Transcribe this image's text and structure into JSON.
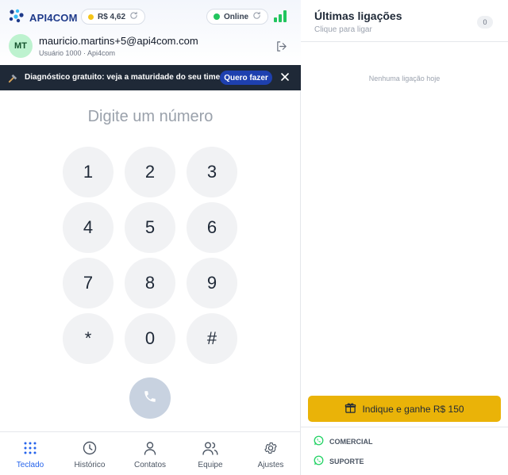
{
  "header": {
    "brand": "API4COM",
    "balance": "R$ 4,62",
    "status": "Online"
  },
  "user": {
    "initials": "MT",
    "email": "mauricio.martins+5@api4com.com",
    "subtitle": "Usuário 1000 · Api4com"
  },
  "banner": {
    "text": "Diagnóstico gratuito: veja a maturidade do seu time",
    "button": "Quero fazer"
  },
  "dialer": {
    "placeholder": "Digite um número",
    "keys": [
      "1",
      "2",
      "3",
      "4",
      "5",
      "6",
      "7",
      "8",
      "9",
      "*",
      "0",
      "#"
    ]
  },
  "nav": {
    "items": [
      {
        "label": "Teclado",
        "icon": "grid-icon",
        "active": true
      },
      {
        "label": "Histórico",
        "icon": "clock-icon",
        "active": false
      },
      {
        "label": "Contatos",
        "icon": "user-icon",
        "active": false
      },
      {
        "label": "Equipe",
        "icon": "users-icon",
        "active": false
      },
      {
        "label": "Ajustes",
        "icon": "gear-icon",
        "active": false
      }
    ]
  },
  "recent": {
    "title": "Últimas ligações",
    "subtitle": "Clique para ligar",
    "count": "0",
    "empty": "Nenhuma ligação hoje"
  },
  "referral": {
    "label": "Indique e ganhe R$ 150"
  },
  "support": {
    "commercial": "COMERCIAL",
    "support": "SUPORTE"
  },
  "colors": {
    "brand": "#1e3a8a",
    "accent": "#2563eb",
    "online": "#22c55e",
    "referral": "#eab308",
    "whatsapp": "#25d366"
  }
}
